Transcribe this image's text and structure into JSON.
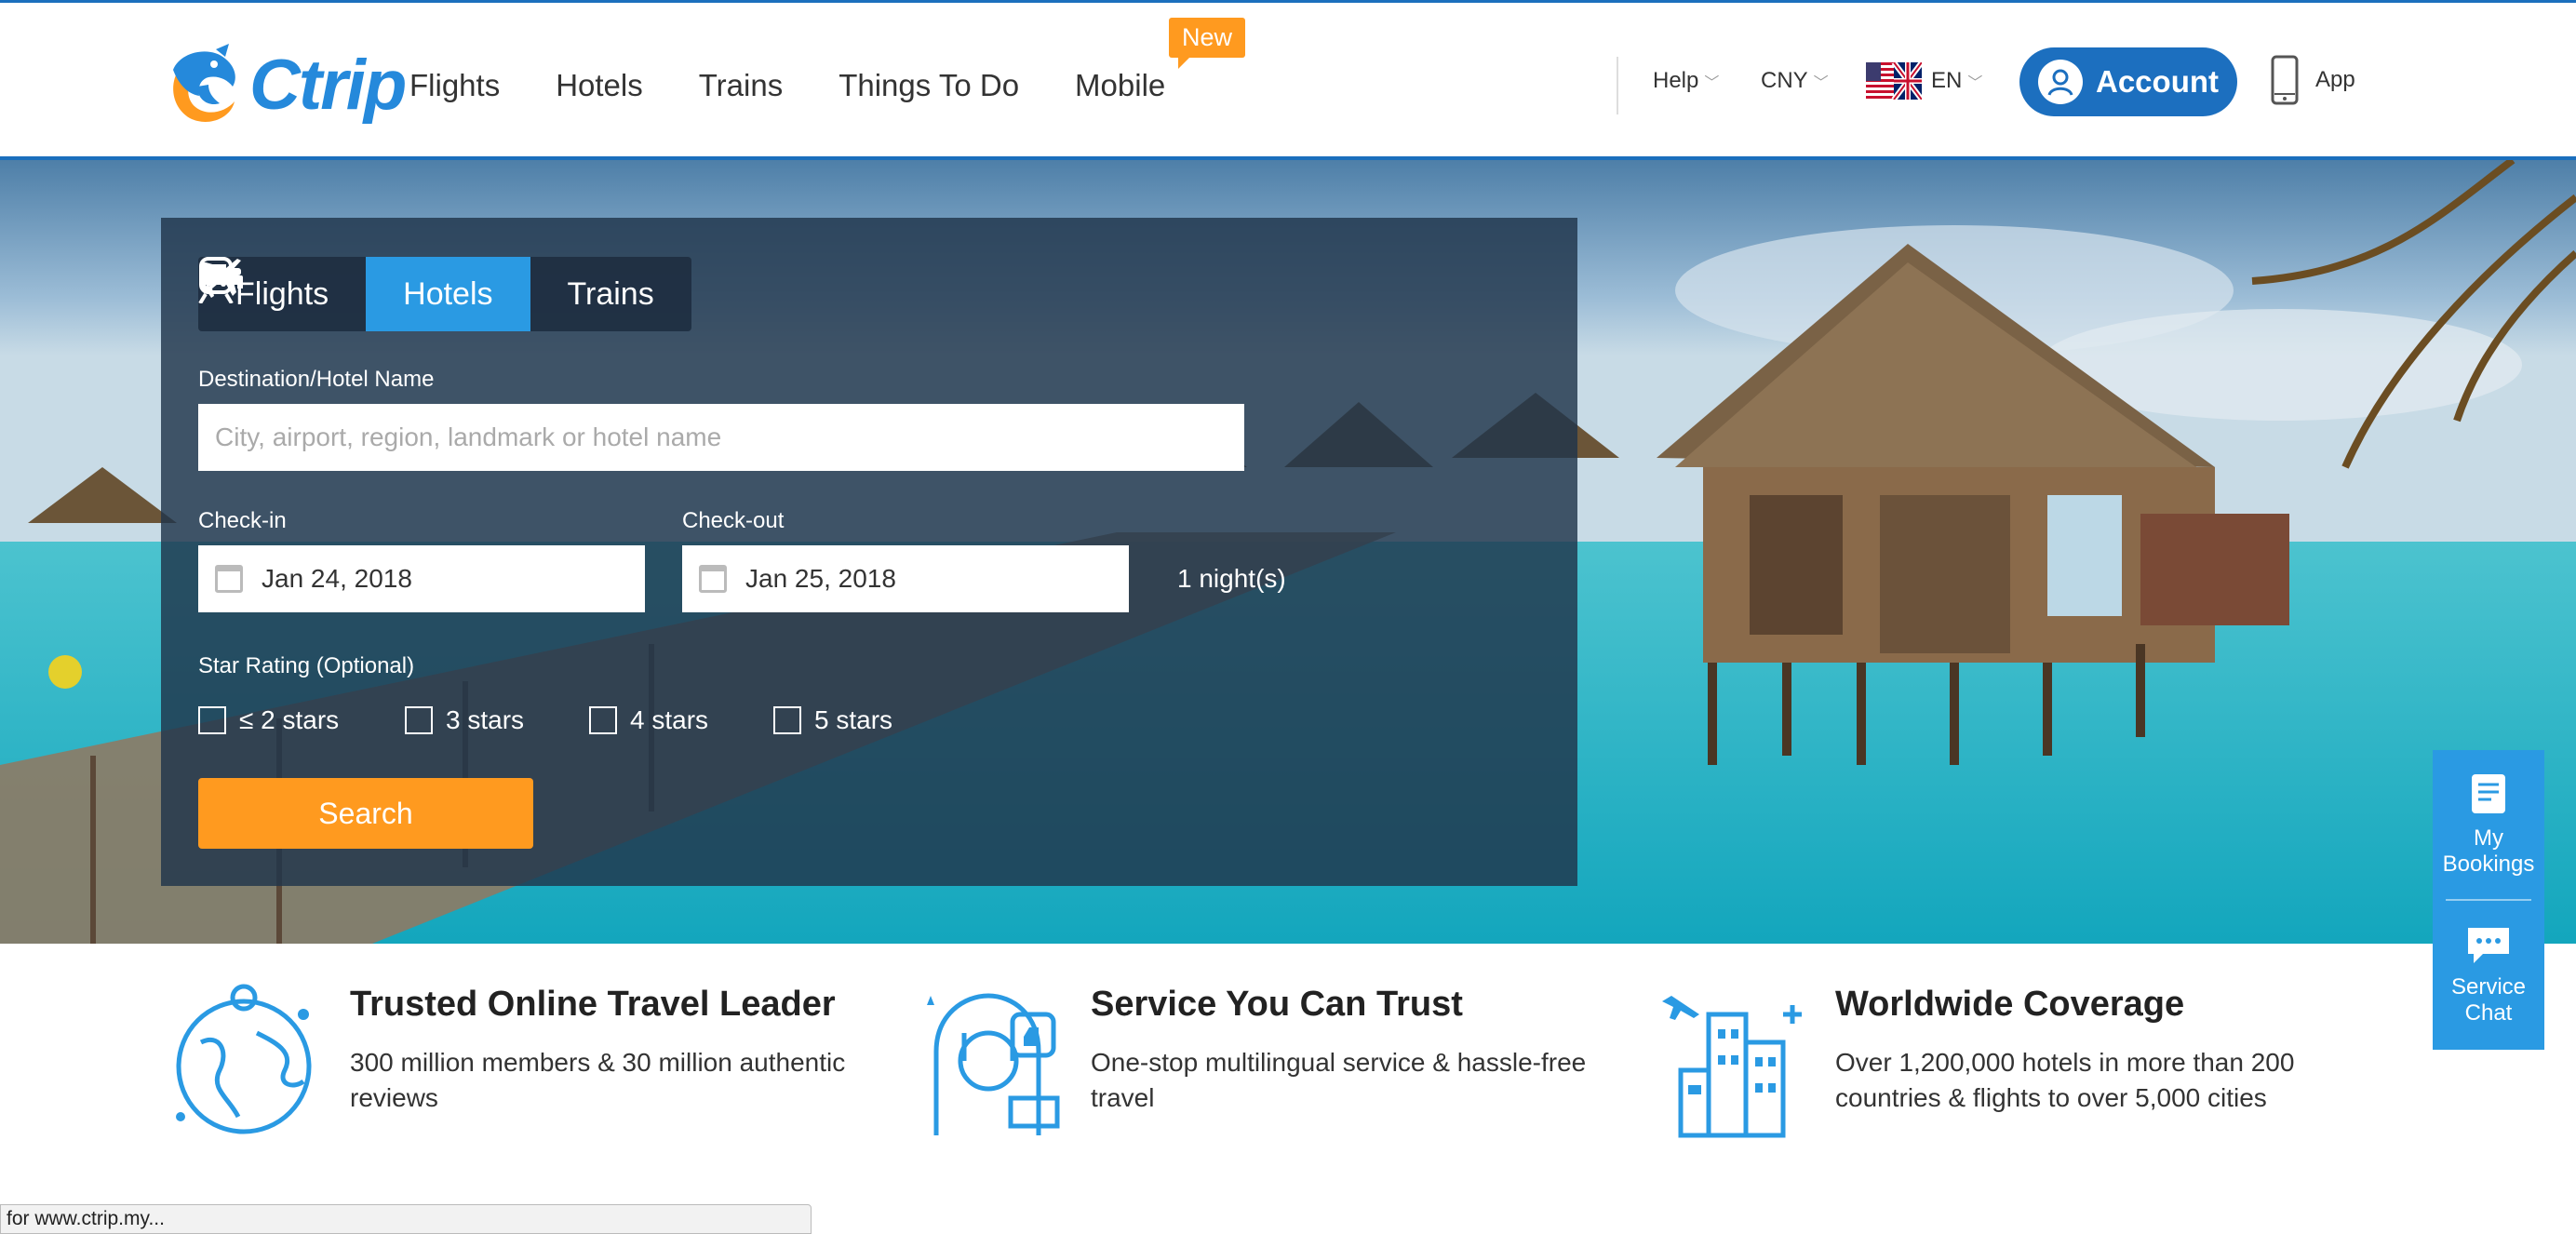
{
  "header": {
    "logo_text": "Ctrip",
    "nav": [
      "Flights",
      "Hotels",
      "Trains",
      "Things To Do",
      "Mobile"
    ],
    "new_badge": "New",
    "help": "Help",
    "currency": "CNY",
    "language": "EN",
    "account": "Account",
    "app": "App"
  },
  "search": {
    "tabs": [
      "Flights",
      "Hotels",
      "Trains"
    ],
    "active_tab": "Hotels",
    "destination_label": "Destination/Hotel Name",
    "destination_placeholder": "City, airport, region, landmark or hotel name",
    "checkin_label": "Check-in",
    "checkin_value": "Jan 24, 2018",
    "checkout_label": "Check-out",
    "checkout_value": "Jan 25, 2018",
    "nights": "1 night(s)",
    "star_label": "Star Rating (Optional)",
    "stars": [
      "≤ 2 stars",
      "3 stars",
      "4 stars",
      "5 stars"
    ],
    "search_button": "Search"
  },
  "features": [
    {
      "title": "Trusted Online Travel Leader",
      "desc": "300 million members & 30 million authentic reviews"
    },
    {
      "title": "Service You Can Trust",
      "desc": "One-stop multilingual service & hassle-free travel"
    },
    {
      "title": "Worldwide Coverage",
      "desc": "Over 1,200,000 hotels in more than 200 countries & flights to over 5,000 cities"
    }
  ],
  "sidebar": {
    "bookings": "My Bookings",
    "chat": "Service Chat"
  },
  "status_bar": "for www.ctrip.my...",
  "colors": {
    "brand_blue": "#1c6fbf",
    "tab_active": "#2a9ae3",
    "orange": "#ff9a1f"
  }
}
